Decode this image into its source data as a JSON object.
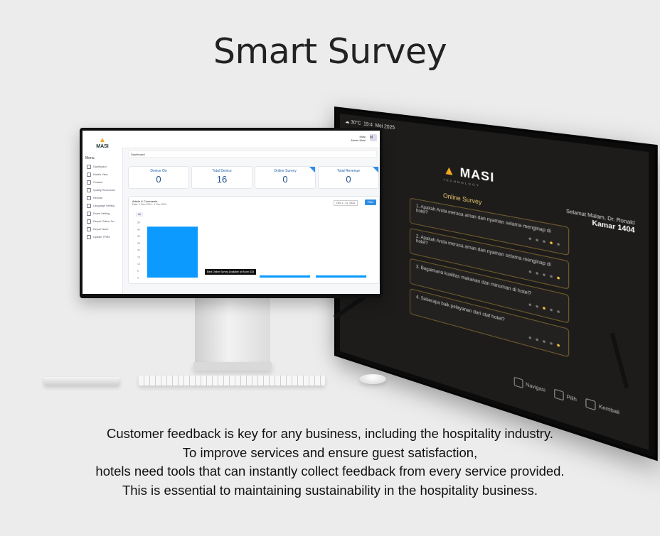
{
  "headline": "Smart Survey",
  "tv": {
    "weather": "30°C",
    "time": "19:4",
    "date": "Mei 2025",
    "brand": "MASI",
    "brand_sub": "TECHNOLOGY",
    "title": "Online Survey",
    "greeting": "Selamat Malam, Dr. Ronald",
    "room": "Kamar 1404",
    "questions": [
      "1. Apakah Anda merasa aman dan nyaman selama menginap di hotel?",
      "2. Apakah Anda merasa aman dan nyaman selama menginap di hotel?",
      "3. Bagaimana kualitas makanan dan minuman di hotel?",
      "4. Seberapa baik pelayanan dari staf hotel?"
    ],
    "nav": [
      "Navigasi",
      "Pilih",
      "Kembali"
    ]
  },
  "dashboard": {
    "brand": "MASI",
    "menu_label": "Menu",
    "sidebar": [
      "Dashboard",
      "Mobile View",
      "Content",
      "Quality Resources",
      "Remote",
      "Language Setting",
      "Room Setting",
      "Report Online Su...",
      "Report Issue",
      "Update TPMS"
    ],
    "user_name": "Masi",
    "user_role": "Admin Masi",
    "avatar": "M",
    "breadcrumb": "Dashboard",
    "stats": [
      {
        "label": "Device On",
        "value": "0"
      },
      {
        "label": "Total Device",
        "value": "16"
      },
      {
        "label": "Online Survey",
        "value": "0"
      },
      {
        "label": "Total Revenue",
        "value": "0"
      }
    ],
    "chart_card": {
      "title": "Article & Comments",
      "subtitle": "Date: 1 Dec 2024 - 1 Dec 2024",
      "date_range": "Dec 1 - 31, 2024",
      "filter": "Filter",
      "chip": "All",
      "tooltip": "Best Online Survey Available at Room 333"
    },
    "chart_data": {
      "type": "bar",
      "categories": [
        "",
        "",
        "",
        ""
      ],
      "values": [
        46,
        0,
        2,
        2
      ],
      "ylim": [
        0,
        50
      ],
      "yticks": [
        "50",
        "40",
        "30",
        "25",
        "20",
        "15",
        "10",
        "5",
        "0"
      ],
      "title": "",
      "xlabel": "",
      "ylabel": ""
    }
  },
  "description": [
    "Customer feedback is key for any business, including the hospitality industry.",
    "To improve services and ensure guest satisfaction,",
    "hotels need tools that can instantly collect feedback from every service provided.",
    "This is essential to maintaining sustainability in the hospitality business."
  ],
  "colors": {
    "accent": "#2f8de4",
    "bar": "#0d9aff",
    "brand_orange": "#f5a623",
    "gold": "#e8c66a"
  }
}
